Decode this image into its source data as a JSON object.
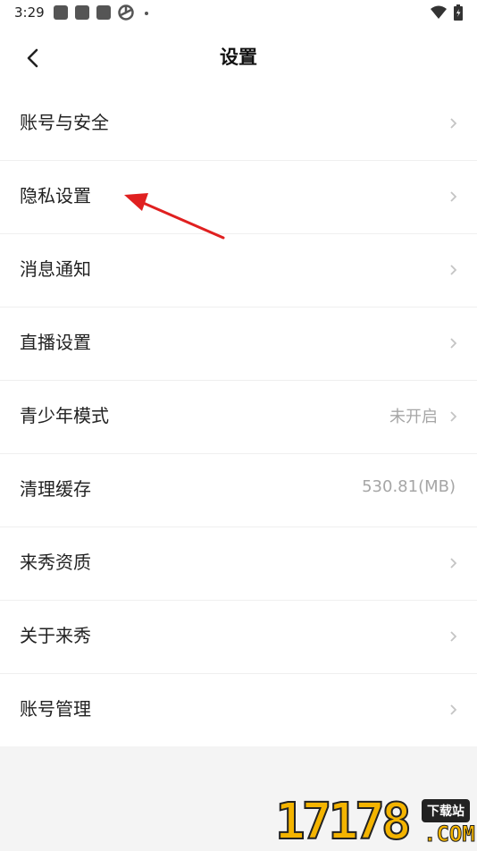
{
  "status_bar": {
    "time": "3:29",
    "icons": [
      "notification-square-icon",
      "notification-square-icon",
      "notification-square-icon",
      "aperture-icon",
      "dot-icon",
      "wifi-icon",
      "battery-icon"
    ]
  },
  "header": {
    "title": "设置",
    "back_icon": "chevron-left-icon"
  },
  "settings": [
    {
      "label": "账号与安全",
      "value": "",
      "chevron": true
    },
    {
      "label": "隐私设置",
      "value": "",
      "chevron": true
    },
    {
      "label": "消息通知",
      "value": "",
      "chevron": true
    },
    {
      "label": "直播设置",
      "value": "",
      "chevron": true
    },
    {
      "label": "青少年模式",
      "value": "未开启",
      "chevron": true
    },
    {
      "label": "清理缓存",
      "value": "530.81(MB)",
      "chevron": false
    },
    {
      "label": "来秀资质",
      "value": "",
      "chevron": true
    },
    {
      "label": "关于来秀",
      "value": "",
      "chevron": true
    },
    {
      "label": "账号管理",
      "value": "",
      "chevron": true
    }
  ],
  "watermark": {
    "number": "17178",
    "badge": "下载站",
    "domain": ".COM"
  },
  "colors": {
    "background": "#f4f4f4",
    "card": "#ffffff",
    "text_primary": "#222222",
    "text_secondary": "#a6a6a6",
    "annotation_arrow": "#e02020",
    "watermark_yellow": "#f4b400"
  }
}
